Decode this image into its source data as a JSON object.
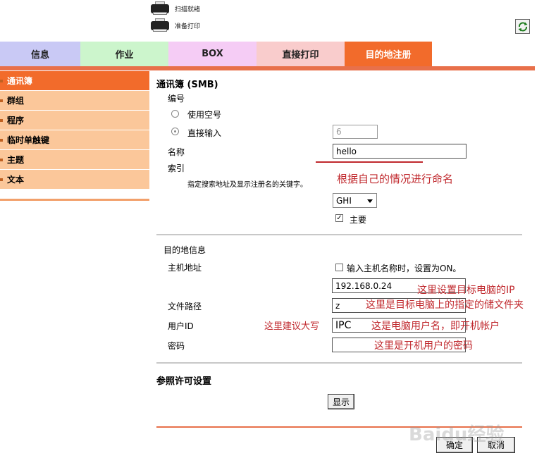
{
  "header": {
    "status_scan": "扫描就绪",
    "status_print": "准备打印"
  },
  "tabs": [
    {
      "label": "信息",
      "color": "#c9c9f5"
    },
    {
      "label": "作业",
      "color": "#ccf5cc"
    },
    {
      "label": "BOX",
      "color": "#f5ccf5"
    },
    {
      "label": "直接打印",
      "color": "#f9cccc"
    },
    {
      "label": "目的地注册",
      "color": "#f26b2b"
    }
  ],
  "sidebar": {
    "items": [
      {
        "label": "通讯簿"
      },
      {
        "label": "群组"
      },
      {
        "label": "程序"
      },
      {
        "label": "临时单触键"
      },
      {
        "label": "主题"
      },
      {
        "label": "文本"
      }
    ]
  },
  "form": {
    "title": "通讯簿 (SMB)",
    "number_label": "编号",
    "use_empty_label": "使用空号",
    "direct_input_label": "直接输入",
    "number_value": "6",
    "name_label": "名称",
    "name_value": "hello",
    "index_label": "索引",
    "index_desc": "指定搜索地址及显示注册名的关键字。",
    "index_select": "GHI",
    "main_label": "主要",
    "dest_info_label": "目的地信息",
    "host_label": "主机地址",
    "host_check_label": "输入主机名称时，设置为ON。",
    "host_value": "192.168.0.24",
    "path_label": "文件路径",
    "path_value": "z",
    "user_label": "用户ID",
    "user_value": "IPC",
    "password_label": "密码",
    "password_value": "",
    "permission_title": "参照许可设置",
    "show_button": "显示",
    "ok_button": "确定",
    "cancel_button": "取消"
  },
  "annotations": {
    "name_note": "根据自己的情况进行命名",
    "ip_note": "这里设置目标电脑的IP",
    "path_note": "这里是目标电脑上的指定的储文件夹",
    "caps_note": "这里建议大写",
    "user_note": "这是电脑用户名，即开机帐户",
    "pwd_note": "这里是开机用户的密码"
  },
  "watermark": "Baidu经验",
  "colors": {
    "accent": "#f26b2b",
    "annotation": "#c0282d"
  }
}
